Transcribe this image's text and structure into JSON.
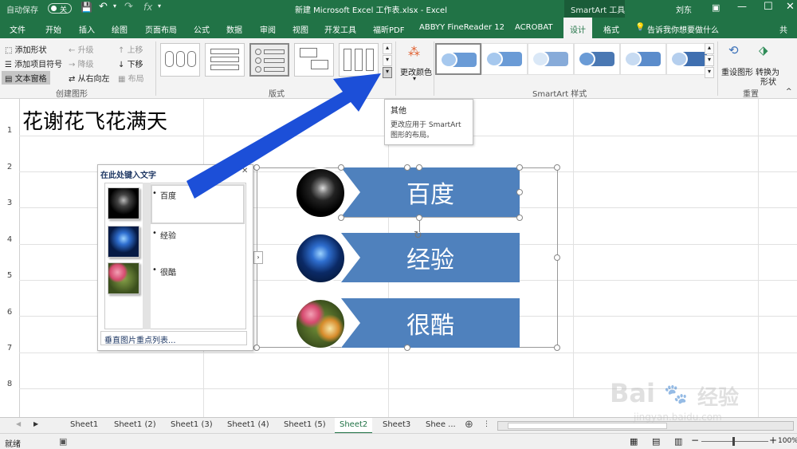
{
  "titlebar": {
    "autosave_label": "自动保存",
    "autosave_state": "关",
    "title": "新建 Microsoft Excel 工作表.xlsx - Excel",
    "smartart_tools": "SmartArt 工具",
    "user": "刘东"
  },
  "tabs": [
    "文件",
    "开始",
    "插入",
    "绘图",
    "页面布局",
    "公式",
    "数据",
    "审阅",
    "视图",
    "开发工具",
    "福昕PDF",
    "ABBYY FineReader 12",
    "ACROBAT",
    "设计",
    "格式"
  ],
  "active_tab": "设计",
  "tell_me": "告诉我你想要做什么",
  "share_label": "共",
  "ribbon": {
    "create_graphic": {
      "add_shape": "添加形状",
      "add_bullet": "添加项目符号",
      "text_pane": "文本窗格",
      "promote": "升级",
      "demote": "降级",
      "right_to_left": "从右向左",
      "move_up": "上移",
      "move_down": "下移",
      "layout": "布局",
      "group_label": "创建图形"
    },
    "layouts_label": "版式",
    "change_colors": "更改颜色",
    "styles_label": "SmartArt 样式",
    "reset_graphic": "重设图形",
    "convert_line1": "转换为",
    "convert_line2": "形状",
    "reset_label": "重置"
  },
  "tooltip": {
    "title": "其他",
    "line1": "更改应用于 SmartArt",
    "line2": "图形的布局。"
  },
  "cell_a1": "花谢花飞花满天",
  "row_numbers": [
    "1",
    "2",
    "3",
    "4",
    "5",
    "6",
    "7",
    "8"
  ],
  "text_pane": {
    "title": "在此处键入文字",
    "items": [
      "百度",
      "经验",
      "很酷"
    ],
    "footer": "垂直图片重点列表..."
  },
  "smartart": {
    "items": [
      "百度",
      "经验",
      "很酷"
    ]
  },
  "sheets": [
    "Sheet1",
    "Sheet1 (2)",
    "Sheet1 (3)",
    "Sheet1 (4)",
    "Sheet1 (5)",
    "Sheet2",
    "Sheet3",
    "Shee ..."
  ],
  "active_sheet": "Sheet2",
  "status": {
    "ready": "就绪",
    "zoom": "100%"
  },
  "watermark": {
    "brand": "Bai",
    "brand_cn": "经验",
    "url": "jingyan.baidu.com"
  },
  "colors": {
    "excel_green": "#217346",
    "smartart_blue": "#4f81bd",
    "arrow_blue": "#1c4fd8"
  }
}
